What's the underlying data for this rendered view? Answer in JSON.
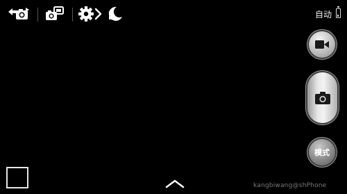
{
  "toolbar": {
    "items": [
      {
        "icon": "switch-camera-icon"
      },
      {
        "icon": "shooting-mode-camera-icon"
      },
      {
        "icon": "settings-gear-icon"
      },
      {
        "icon": "night-mode-icon"
      }
    ]
  },
  "status": {
    "mode_text": "自动",
    "battery_icon": "battery-icon"
  },
  "controls": {
    "video_icon": "video-camera-icon",
    "photo_icon": "camera-shutter-icon",
    "mode_label": "模式"
  },
  "bottom": {
    "chevron_icon": "chevron-up-icon",
    "watermark": "kangbiwang@shPhone"
  },
  "colors": {
    "viewfinder": "#000000",
    "button_silver": "#d8d8d8",
    "icon_white": "#ffffff"
  }
}
